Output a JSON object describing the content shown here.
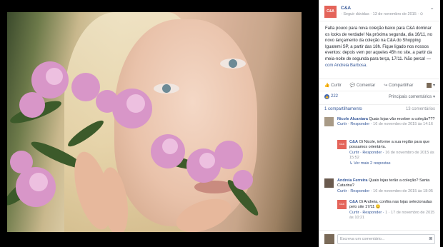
{
  "post": {
    "page_name": "C&A",
    "avatar_text": "C&A",
    "meta": "· Seguir dúvidas · 13 de novembro de 2015 · ⊙",
    "menu_icon": "chevron-down-icon",
    "text_1": "Falta pouco para nova coleção baixo para C&A dominar os looks de verdade! Na próxima segunda, dia 16/11, no novo lançamento da coleção na C&A do Shopping Iguatemi SP, a partir das 18h. Fique ligado nos nossos eventos: depois vem por aqueles 45h no site, a partir da meia-noite de segunda para terça, 17/11. Não perca! —",
    "text_tag": "com Andreia Barbosa.",
    "like_label": "Curtir",
    "comment_label": "Comentar",
    "share_label": "Compartilhar",
    "likes_count": "222",
    "likes_sort": "Principais comentários ▾",
    "comments_link": "1 compartilhamento",
    "comments_count": "13 comentários"
  },
  "comments": [
    {
      "name": "Nicole Alcantara",
      "text": "Quais lojas vão receber a coleção???",
      "meta_actions": "Curtir · Responder ·",
      "meta_time": "16 de novembro de 2015 às 14:16"
    },
    {
      "name": "C&A",
      "avatar_text": "C&A",
      "text": "Oi Nicole, informe a sua região para que possamos orientá-la.",
      "meta_actions": "Curtir · Responder ·",
      "meta_time": "16 de novembro de 2015 às 15:52",
      "hidden": "↳ Ver mais 2 respostas"
    },
    {
      "name": "Andreia Ferreira",
      "text": "Quais lojas terão a coleção? Santa Catarina?",
      "meta_actions": "Curtir · Responder ·",
      "meta_time": "16 de novembro de 2015 às 18:05"
    },
    {
      "name": "C&A",
      "avatar_text": "C&A",
      "text": "Oi Andreia, confira nas lojas selecionadas pelo site 17/11 😊",
      "meta_actions": "Curtir · Responder · ",
      "meta_time": "1 · 17 de novembro de 2015 às 10:21"
    }
  ],
  "composer": {
    "placeholder": "Escreva um comentário...",
    "camera_icon": "camera-icon"
  },
  "colors": {
    "brand": "#e4645a",
    "link": "#365899",
    "muted": "#90949c"
  }
}
